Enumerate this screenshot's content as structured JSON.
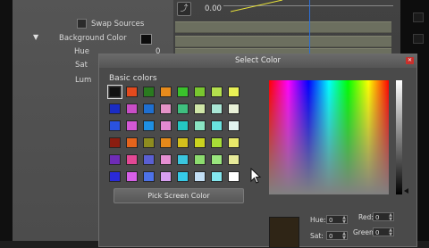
{
  "editor": {
    "swap_sources_label": "Swap Sources",
    "background_color_label": "Background Color",
    "hue_label": "Hue",
    "sat_label": "Sat",
    "lum_label": "Lum",
    "hue_value": "0",
    "time_readout": "0.00",
    "time_icon": "graph-icon"
  },
  "dialog": {
    "title": "Select Color",
    "close_icon": "close-icon",
    "basic_colors_label": "Basic colors",
    "pick_screen_color_label": "Pick Screen Color",
    "basic_colors": [
      [
        "#111111",
        "#e34a1d",
        "#2a7a1f",
        "#e78b1c",
        "#3ac12c",
        "#79c72f",
        "#b4e04d",
        "#e8f055"
      ],
      [
        "#1a2cc4",
        "#c84ec7",
        "#1f6fd0",
        "#e493c8",
        "#3fbf7f",
        "#cfe6a7",
        "#a9e6d5",
        "#e8f0d8"
      ],
      [
        "#2a52e0",
        "#d458d6",
        "#1e8fe3",
        "#e38ad0",
        "#24c7c2",
        "#8ae4c2",
        "#69e2df",
        "#e2f4f0"
      ],
      [
        "#8b1d10",
        "#e5641c",
        "#8e8c1f",
        "#e5891a",
        "#d3c01c",
        "#cbd31f",
        "#a8de37",
        "#e8e86a"
      ],
      [
        "#6f2cb7",
        "#e34895",
        "#5a5fd3",
        "#e58fd2",
        "#3ac6de",
        "#8ddc6f",
        "#9ae57e",
        "#e7ea9a"
      ],
      [
        "#2a2ad9",
        "#d760e8",
        "#4d72e8",
        "#d89ff0",
        "#36cbe8",
        "#c3dff5",
        "#84e7ef",
        "#ffffff"
      ]
    ],
    "hue_label": "Hue:",
    "sat_label": "Sat:",
    "red_label": "Red:",
    "green_label": "Green:",
    "hue_value": "0",
    "sat_value": "0",
    "red_value": "0",
    "green_value": "0"
  }
}
